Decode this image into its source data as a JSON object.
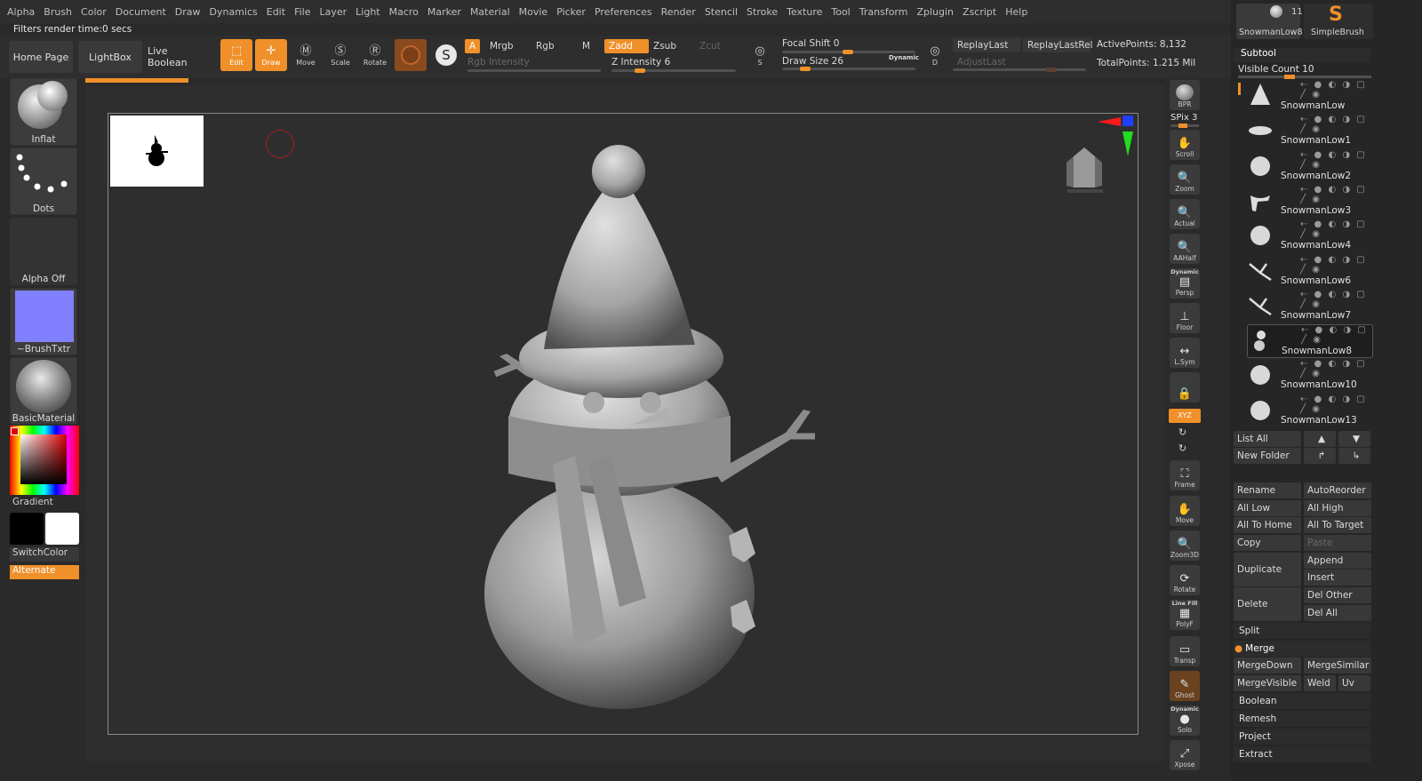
{
  "menu": [
    "Alpha",
    "Brush",
    "Color",
    "Document",
    "Draw",
    "Dynamics",
    "Edit",
    "File",
    "Layer",
    "Light",
    "Macro",
    "Marker",
    "Material",
    "Movie",
    "Picker",
    "Preferences",
    "Render",
    "Stencil",
    "Stroke",
    "Texture",
    "Tool",
    "Transform",
    "Zplugin",
    "Zscript",
    "Help"
  ],
  "status_text": "Filters render time:0 secs",
  "shelf": {
    "tabs": [
      "Home Page",
      "LightBox",
      "Live Boolean"
    ],
    "tools": {
      "edit": "Edit",
      "draw": "Draw",
      "move": "Move",
      "scale": "Scale",
      "rotate": "Rotate"
    },
    "a": "A",
    "mrgb": "Mrgb",
    "rgb": "Rgb",
    "m": "M",
    "zadd": "Zadd",
    "zsub": "Zsub",
    "zcut": "Zcut",
    "rgb_intensity": "Rgb Intensity",
    "z_intensity": "Z Intensity 6",
    "focal_shift": "Focal Shift 0",
    "draw_size": "Draw Size 26",
    "dynamic": "Dynamic",
    "replay_last": "ReplayLast",
    "replay_last_rel": "ReplayLastRel",
    "adjust_last": "AdjustLast",
    "active_points": "ActivePoints: 8,132",
    "total_points": "TotalPoints: 1.215 Mil",
    "s_label": "S",
    "d_label": "D"
  },
  "left": {
    "brush": "Inflat",
    "stroke": "Dots",
    "alpha": "Alpha Off",
    "texture": "~BrushTxtr",
    "material": "BasicMaterial",
    "gradient": "Gradient",
    "switch": "SwitchColor",
    "alternate": "Alternate",
    "colors": {
      "texture": "#8080ff",
      "main": "#000000",
      "secondary": "#ffffff",
      "accent": "#f0902a"
    }
  },
  "right_strip": {
    "bpr": "BPR",
    "spix": "SPix 3",
    "buttons": [
      "Scroll",
      "Zoom",
      "Actual",
      "AAHalf",
      "Persp",
      "Floor",
      "L.Sym",
      "",
      "Frame",
      "Move",
      "Zoom3D",
      "Rotate",
      "PolyF",
      "Transp",
      "Ghost",
      "Solo",
      "Xpose"
    ],
    "persp_top": "Dynamic",
    "solo_top": "Dynamic",
    "polyf_top": "Line Fill",
    "xyz": "XYZ"
  },
  "top_tools": {
    "current": "SnowmanLow8",
    "count": "11",
    "brush": "SimpleBrush"
  },
  "subtool": {
    "title": "Subtool",
    "visible_count": "Visible Count 10",
    "items": [
      "SnowmanLow",
      "SnowmanLow1",
      "SnowmanLow2",
      "SnowmanLow3",
      "SnowmanLow4",
      "SnowmanLow6",
      "SnowmanLow7",
      "SnowmanLow8",
      "SnowmanLow10",
      "SnowmanLow13"
    ],
    "selected": "SnowmanLow8",
    "list_all": "List All",
    "new_folder": "New Folder",
    "buttons": {
      "rename": "Rename",
      "autoreorder": "AutoReorder",
      "all_low": "All Low",
      "all_high": "All High",
      "all_to_home": "All To Home",
      "all_to_target": "All To Target",
      "copy": "Copy",
      "paste": "Paste",
      "duplicate": "Duplicate",
      "append": "Append",
      "insert": "Insert",
      "delete": "Delete",
      "del_other": "Del Other",
      "del_all": "Del All",
      "split": "Split",
      "merge": "Merge",
      "merge_down": "MergeDown",
      "merge_similar": "MergeSimilar",
      "merge_visible": "MergeVisible",
      "weld": "Weld",
      "uv": "Uv",
      "boolean": "Boolean",
      "remesh": "Remesh",
      "project": "Project",
      "extract": "Extract"
    }
  }
}
